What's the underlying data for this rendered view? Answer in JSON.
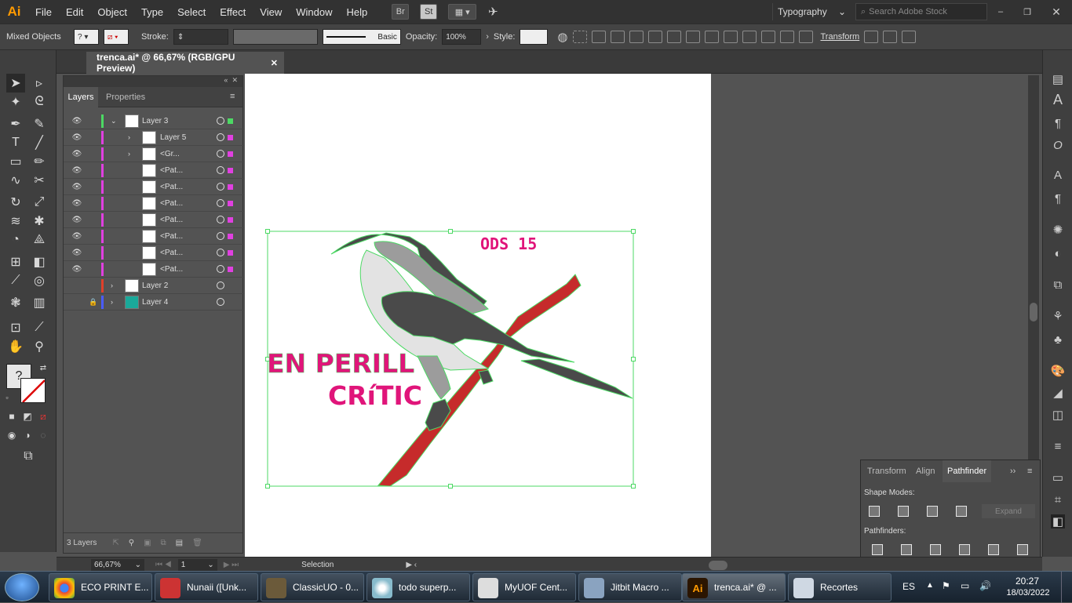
{
  "menubar": {
    "app_logo": "Ai",
    "items": [
      "File",
      "Edit",
      "Object",
      "Type",
      "Select",
      "Effect",
      "View",
      "Window",
      "Help"
    ],
    "bridge_label": "Br",
    "stock_label": "St",
    "workspace": "Typography",
    "search_placeholder": "Search Adobe Stock"
  },
  "controlbar": {
    "selection_type": "Mixed Objects",
    "stroke_label": "Stroke:",
    "brush_label": "Basic",
    "opacity_label": "Opacity:",
    "opacity_value": "100%",
    "style_label": "Style:",
    "transform_label": "Transform"
  },
  "document": {
    "tab_title": "trenca.ai* @ 66,67% (RGB/GPU Preview)"
  },
  "layers_panel": {
    "tabs": [
      "Layers",
      "Properties"
    ],
    "rows": [
      {
        "name": "Layer 3",
        "color": "#4cd964"
      },
      {
        "name": "Layer 5",
        "color": "#e040e0"
      },
      {
        "name": "<Gr...",
        "color": "#e040e0"
      },
      {
        "name": "<Pat...",
        "color": "#e040e0"
      },
      {
        "name": "<Pat...",
        "color": "#e040e0"
      },
      {
        "name": "<Pat...",
        "color": "#e040e0"
      },
      {
        "name": "<Pat...",
        "color": "#e040e0"
      },
      {
        "name": "<Pat...",
        "color": "#e040e0"
      },
      {
        "name": "<Pat...",
        "color": "#e040e0"
      },
      {
        "name": "<Pat...",
        "color": "#e040e0"
      },
      {
        "name": "Layer 2",
        "color": "#e0402a"
      },
      {
        "name": "Layer 4",
        "color": "#4a5cff"
      }
    ],
    "footer": "3 Layers"
  },
  "artwork": {
    "text_top": "ODS 15",
    "text_line1": "EN PERILL",
    "text_line2": "CRíTIC",
    "pink": "#e0157a",
    "branch_red": "#c62b2b",
    "bird_dark": "#4a4a4a",
    "bird_mid": "#9c9c9c",
    "bird_light": "#e3e3e3",
    "selection_green": "#4cd964"
  },
  "pathfinder_panel": {
    "tabs": [
      "Transform",
      "Align",
      "Pathfinder"
    ],
    "active_tab": "Pathfinder",
    "shape_modes_label": "Shape Modes:",
    "expand_label": "Expand",
    "pathfinders_label": "Pathfinders:"
  },
  "statusbar": {
    "zoom": "66,67%",
    "artboard": "1",
    "tool": "Selection"
  },
  "taskbar": {
    "tasks": [
      "ECO PRINT E...",
      "Nunaii ([Unk...",
      "ClassicUO - 0...",
      "todo superp...",
      "MyUOF Cent...",
      "Jitbit Macro ...",
      "trenca.ai* @ ...",
      "Recortes"
    ],
    "language": "ES",
    "time": "20:27",
    "date": "18/03/2022"
  }
}
